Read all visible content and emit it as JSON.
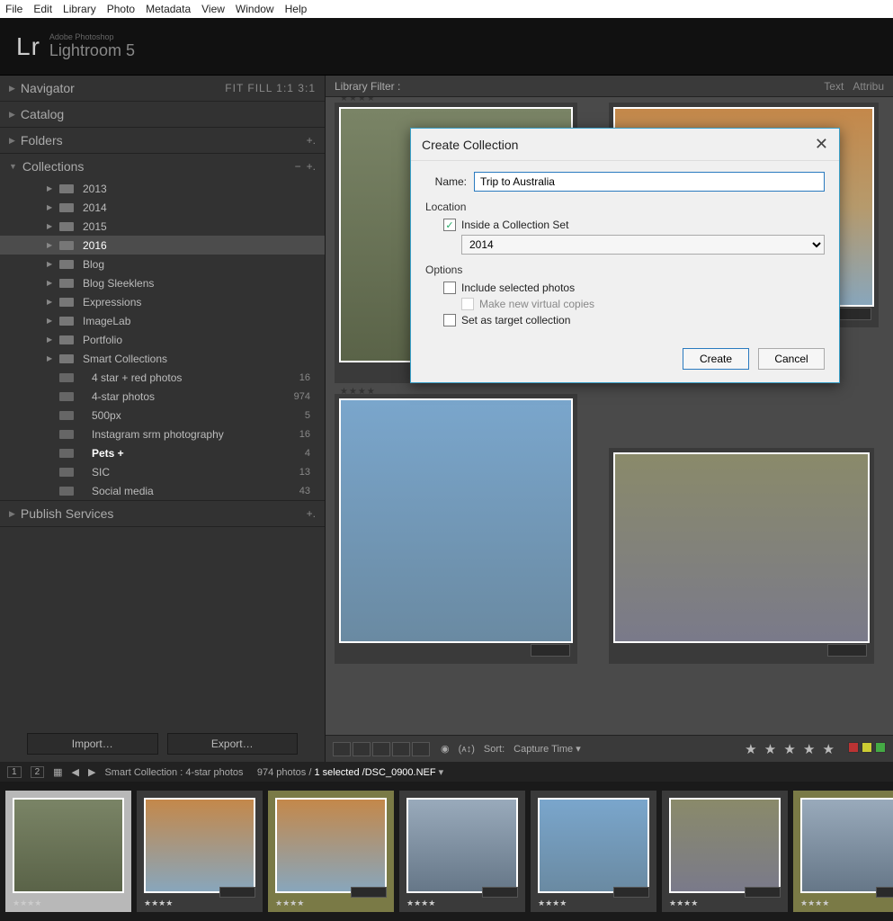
{
  "menu": [
    "File",
    "Edit",
    "Library",
    "Photo",
    "Metadata",
    "View",
    "Window",
    "Help"
  ],
  "brand": {
    "logo": "Lr",
    "line1": "Adobe Photoshop",
    "line2": "Lightroom 5"
  },
  "panels": {
    "navigator": {
      "title": "Navigator",
      "opts": "FIT   FILL   1:1   3:1"
    },
    "catalog": {
      "title": "Catalog"
    },
    "folders": {
      "title": "Folders"
    },
    "collections": {
      "title": "Collections",
      "items": [
        {
          "type": "set",
          "label": "2013"
        },
        {
          "type": "set",
          "label": "2014"
        },
        {
          "type": "set",
          "label": "2015"
        },
        {
          "type": "set",
          "label": "2016",
          "selected": true
        },
        {
          "type": "set",
          "label": "Blog"
        },
        {
          "type": "set",
          "label": "Blog Sleeklens"
        },
        {
          "type": "set",
          "label": "Expressions"
        },
        {
          "type": "set",
          "label": "ImageLab"
        },
        {
          "type": "set",
          "label": "Portfolio"
        },
        {
          "type": "set",
          "label": "Smart Collections"
        },
        {
          "type": "smart",
          "label": "4 star + red photos",
          "count": "16"
        },
        {
          "type": "smart",
          "label": "4-star photos",
          "count": "974"
        },
        {
          "type": "smart",
          "label": "500px",
          "count": "5"
        },
        {
          "type": "smart",
          "label": "Instagram srm photography",
          "count": "16"
        },
        {
          "type": "coll",
          "label": "Pets  +",
          "count": "4",
          "bold": true
        },
        {
          "type": "coll",
          "label": "SIC",
          "count": "13"
        },
        {
          "type": "coll",
          "label": "Social media",
          "count": "43"
        }
      ]
    },
    "publish": {
      "title": "Publish Services"
    }
  },
  "buttons": {
    "import": "Import…",
    "export": "Export…"
  },
  "libraryFilter": {
    "label": "Library Filter :",
    "right": [
      "Text",
      "Attribu"
    ]
  },
  "dialog": {
    "title": "Create Collection",
    "name_label": "Name:",
    "name_value": "Trip to Australia",
    "location_label": "Location",
    "inside_label": "Inside a Collection Set",
    "inside_checked": true,
    "parent_value": "2014",
    "options_label": "Options",
    "include_label": "Include selected photos",
    "virtual_label": "Make new virtual copies",
    "target_label": "Set as target collection",
    "create": "Create",
    "cancel": "Cancel"
  },
  "toolbar": {
    "sort_label": "Sort:",
    "sort_value": "Capture Time",
    "rating": "★ ★ ★ ★ ★"
  },
  "statusbar": {
    "collection": "Smart Collection : 4-star photos",
    "count": "974 photos /",
    "selected": "1 selected",
    "file": "/DSC_0900.NEF"
  },
  "stars": "★★★★"
}
